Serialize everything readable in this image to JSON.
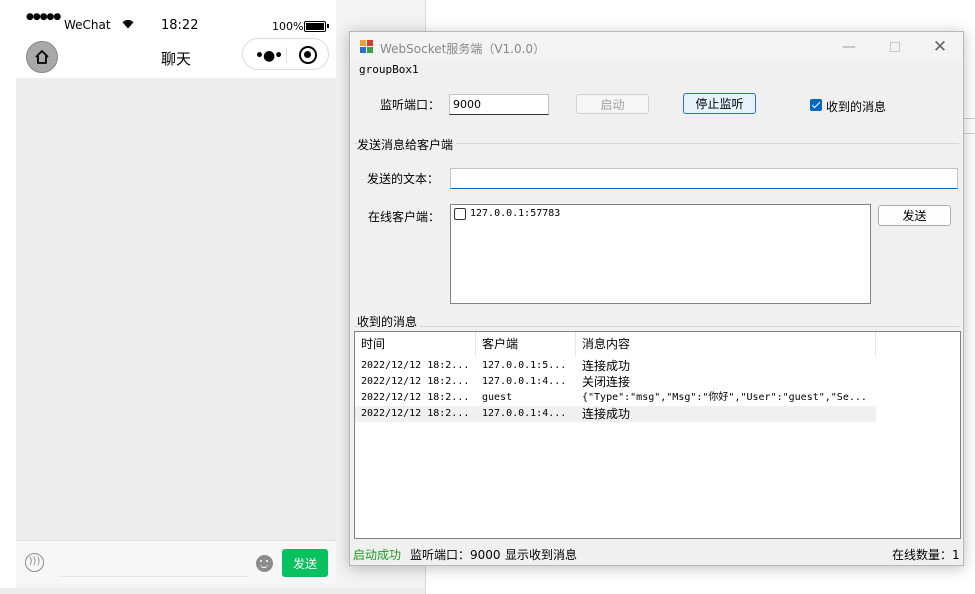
{
  "phone": {
    "status": {
      "signal_dots": "●●●●●",
      "carrier": "WeChat",
      "time": "18:22",
      "battery": "100%",
      "battery_level": 1.0
    },
    "nav": {
      "title": "聊天"
    },
    "input": {
      "send_label": "发送",
      "message_value": ""
    }
  },
  "window": {
    "title": "WebSocket服务端（V1.0.0）",
    "group1": {
      "label": "groupBox1",
      "port_label": "监听端口：",
      "port_value": "9000",
      "start_label": "启动",
      "stop_label": "停止监听",
      "received_checkbox_label": "收到的消息",
      "received_checked": true
    },
    "send_section": {
      "label": "发送消息给客户端",
      "text_label": "发送的文本：",
      "text_value": "",
      "clients_label": "在线客户端：",
      "clients": [
        {
          "address": "127.0.0.1:57783",
          "checked": false
        }
      ],
      "send_label": "发送"
    },
    "received_section": {
      "label": "收到的消息",
      "columns": [
        "时间",
        "客户端",
        "消息内容"
      ],
      "rows": [
        {
          "time": "2022/12/12 18:2...",
          "client": "127.0.0.1:5...",
          "content": "连接成功"
        },
        {
          "time": "2022/12/12 18:2...",
          "client": "127.0.0.1:4...",
          "content": "关闭连接"
        },
        {
          "time": "2022/12/12 18:2...",
          "client": "guest",
          "content": "{\"Type\":\"msg\",\"Msg\":\"你好\",\"User\":\"guest\",\"Se..."
        },
        {
          "time": "2022/12/12 18:2...",
          "client": "127.0.0.1:4...",
          "content": "连接成功"
        }
      ]
    },
    "statusbar": {
      "status": "启动成功",
      "port_text": "监听端口：9000",
      "show_text": "显示收到消息",
      "online_text": "在线数量：1"
    }
  },
  "colors": {
    "wechat_green": "#07c160",
    "status_green": "#1e9b1e",
    "win_accent": "#0067c0"
  }
}
